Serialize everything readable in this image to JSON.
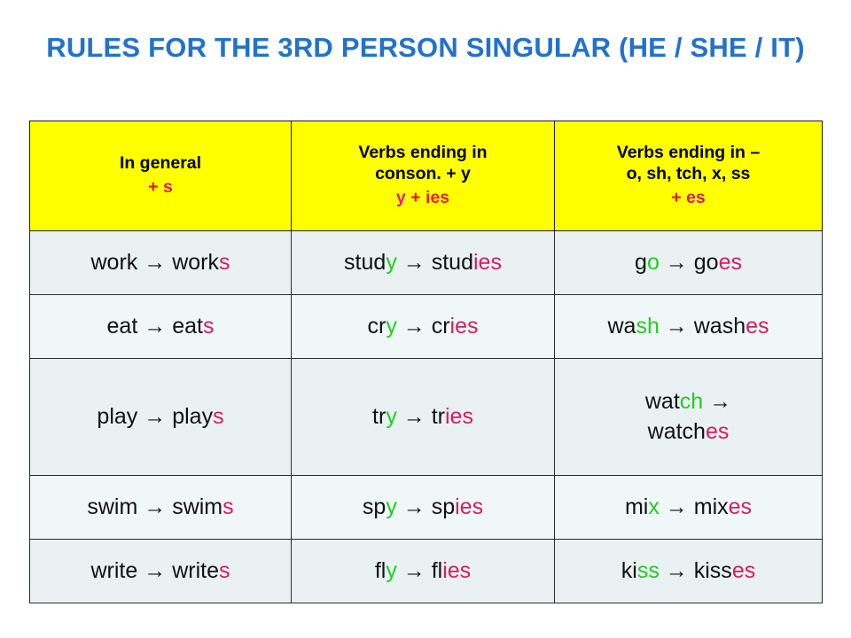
{
  "slide": {
    "title": "Rules for the 3rd person singular (he / she / it)",
    "title_color": "#2272cc",
    "background": "#ffffff"
  },
  "colors": {
    "header_bg": "#ffff00",
    "cell_bg": "#e9f1f2",
    "cell_bg_alt": "#f0f7f8",
    "base_text": "#111111",
    "pink": "#d81b60",
    "green": "#22cc22",
    "red": "#ee1111",
    "magenta": "#e0218a",
    "border": "#2b2b2b"
  },
  "table": {
    "headers": [
      {
        "main": "In general",
        "rule_plus": "+",
        "rule_suffix": "s"
      },
      {
        "main": "Verbs ending in\nconson. + y",
        "rule_base": "y",
        "rule_plus": "+",
        "rule_suffix": "ies"
      },
      {
        "main": "Verbs ending in –\no, sh, tch, x, ss",
        "rule_plus": "+",
        "rule_suffix": "es"
      }
    ],
    "rows": [
      {
        "tall": false,
        "cells": [
          {
            "base": "work",
            "base_hl": "",
            "arrow": "→",
            "stem": "work",
            "suffix": "s"
          },
          {
            "base": "stud",
            "base_hl": "y",
            "arrow": "→",
            "stem": "stud",
            "suffix": "ies"
          },
          {
            "base": "g",
            "base_hl": "o",
            "arrow": "→",
            "stem": "go",
            "suffix": "es"
          }
        ]
      },
      {
        "tall": false,
        "cells": [
          {
            "base": "eat",
            "base_hl": "",
            "arrow": "→",
            "stem": "eat",
            "suffix": "s"
          },
          {
            "base": "cr",
            "base_hl": "y",
            "arrow": "→",
            "stem": "cr",
            "suffix": "ies"
          },
          {
            "base": "wa",
            "base_hl": "sh",
            "arrow": "→",
            "stem": "wash",
            "suffix": "es"
          }
        ]
      },
      {
        "tall": true,
        "cells": [
          {
            "base": "play",
            "base_hl": "",
            "arrow": "→",
            "stem": "play",
            "suffix": "s"
          },
          {
            "base": "tr",
            "base_hl": "y",
            "arrow": "→",
            "stem": "tr",
            "suffix": "ies"
          },
          {
            "base": "wat",
            "base_hl": "ch",
            "arrow": "→",
            "stem": "watch",
            "suffix": "es",
            "wrap": true
          }
        ]
      },
      {
        "tall": false,
        "cells": [
          {
            "base": "swim",
            "base_hl": "",
            "arrow": "→",
            "stem": "swim",
            "suffix": "s"
          },
          {
            "base": "sp",
            "base_hl": "y",
            "arrow": "→",
            "stem": "sp",
            "suffix": "ies"
          },
          {
            "base": "mi",
            "base_hl": "x",
            "arrow": "→",
            "stem": "mix",
            "suffix": "es"
          }
        ]
      },
      {
        "tall": false,
        "cells": [
          {
            "base": "write",
            "base_hl": "",
            "arrow": "→",
            "stem": "write",
            "suffix": "s"
          },
          {
            "base": "fl",
            "base_hl": "y",
            "arrow": "→",
            "stem": "fl",
            "suffix": "ies"
          },
          {
            "base": "ki",
            "base_hl": "ss",
            "arrow": "→",
            "stem": "kiss",
            "suffix": "es"
          }
        ]
      }
    ]
  }
}
